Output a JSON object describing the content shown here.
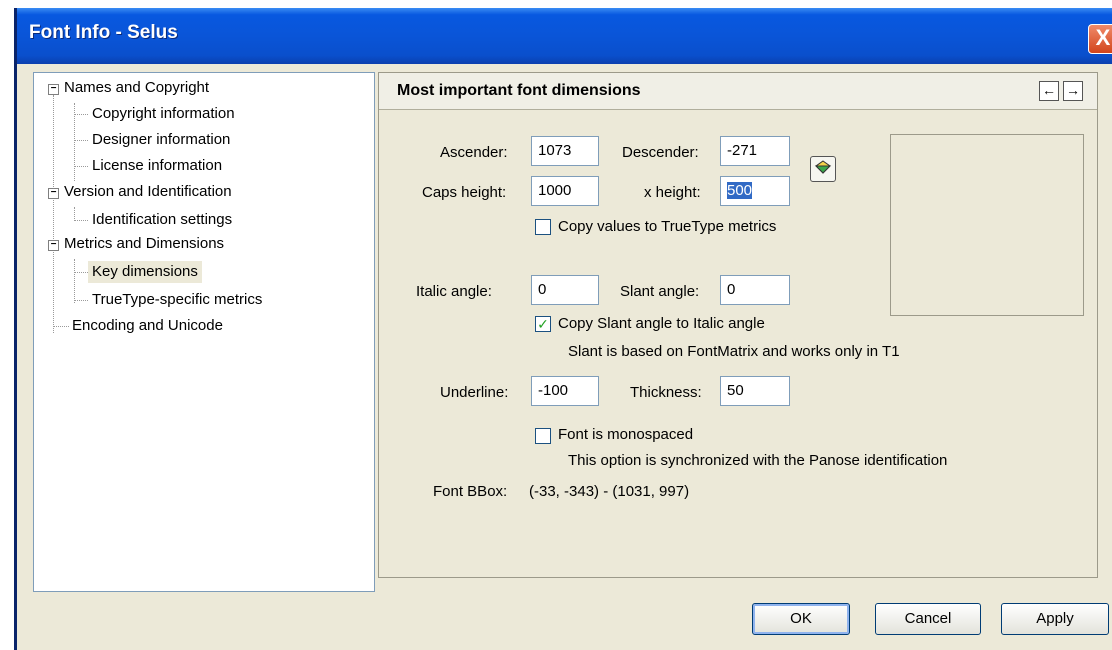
{
  "window": {
    "title": "Font Info - Selus",
    "close_label": "X"
  },
  "tree": {
    "items": [
      {
        "label": "Names and Copyright",
        "expander": "−"
      },
      {
        "label": "Copyright information"
      },
      {
        "label": "Designer information"
      },
      {
        "label": "License information"
      },
      {
        "label": "Version and Identification",
        "expander": "−"
      },
      {
        "label": "Identification settings"
      },
      {
        "label": "Metrics and Dimensions",
        "expander": "−"
      },
      {
        "label": "Key dimensions"
      },
      {
        "label": "TrueType-specific metrics"
      },
      {
        "label": "Encoding and Unicode"
      }
    ]
  },
  "panel": {
    "title": "Most important font dimensions",
    "prev_icon": "←",
    "next_icon": "→",
    "fields": {
      "ascender": {
        "label": "Ascender:",
        "value": "1073"
      },
      "descender": {
        "label": "Descender:",
        "value": "-271"
      },
      "caps_height": {
        "label": "Caps height:",
        "value": "1000"
      },
      "x_height": {
        "label": "x height:",
        "value": "500"
      },
      "italic_angle": {
        "label": "Italic angle:",
        "value": "0"
      },
      "slant_angle": {
        "label": "Slant angle:",
        "value": "0"
      },
      "underline": {
        "label": "Underline:",
        "value": "-100"
      },
      "thickness": {
        "label": "Thickness:",
        "value": "50"
      }
    },
    "checkboxes": {
      "copy_truetype": {
        "label": "Copy values to TrueType metrics",
        "mark": ""
      },
      "copy_slant": {
        "label": "Copy Slant angle to Italic angle",
        "mark": "✓"
      },
      "monospaced": {
        "label": "Font is monospaced",
        "mark": ""
      }
    },
    "notes": {
      "slant": "Slant is based on FontMatrix and works only in T1",
      "mono": "This option is synchronized with the Panose identification"
    },
    "bbox": {
      "label": "Font BBox:",
      "value": "(-33, -343) - (1031, 997)"
    },
    "apply_icon": "diamond-icon"
  },
  "buttons": {
    "ok": "OK",
    "cancel": "Cancel",
    "apply": "Apply"
  }
}
